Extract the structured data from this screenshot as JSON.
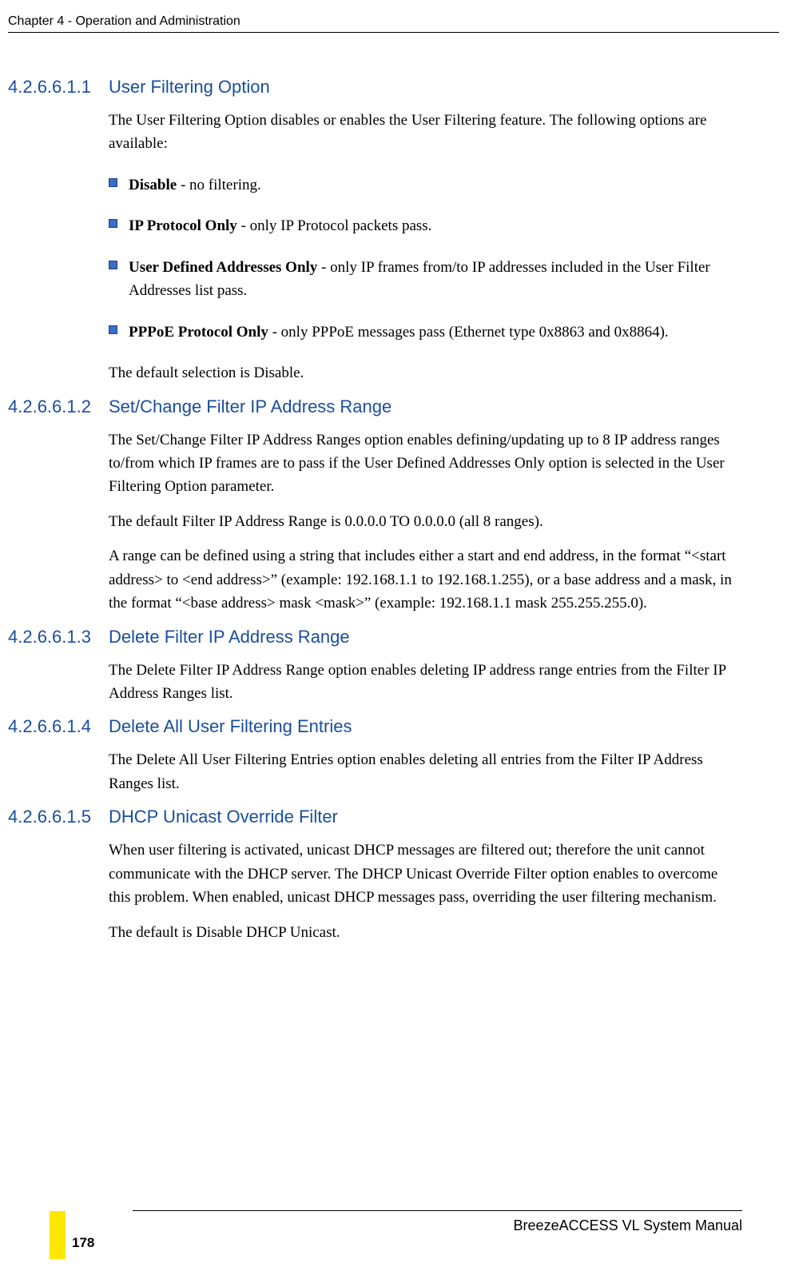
{
  "header": {
    "chapter": "Chapter 4 - Operation and Administration"
  },
  "sections": {
    "s1": {
      "num": "4.2.6.6.1.1",
      "title": "User Filtering Option"
    },
    "s2": {
      "num": "4.2.6.6.1.2",
      "title": "Set/Change Filter IP Address Range"
    },
    "s3": {
      "num": "4.2.6.6.1.3",
      "title": "Delete Filter IP Address Range"
    },
    "s4": {
      "num": "4.2.6.6.1.4",
      "title": "Delete All User Filtering Entries"
    },
    "s5": {
      "num": "4.2.6.6.1.5",
      "title": "DHCP Unicast Override Filter"
    }
  },
  "body": {
    "s1_intro": "The User Filtering Option disables or enables the User Filtering feature. The following options are available:",
    "s1_b1_bold": "Disable",
    "s1_b1_rest": " - no filtering.",
    "s1_b2_bold": "IP Protocol Only",
    "s1_b2_rest": " - only IP Protocol packets pass.",
    "s1_b3_bold": "User Defined Addresses Only",
    "s1_b3_rest": " - only IP frames from/to IP addresses included in the User Filter Addresses list pass.",
    "s1_b4_bold": "PPPoE Protocol Only",
    "s1_b4_rest": " - only PPPoE messages pass (Ethernet type 0x8863 and 0x8864).",
    "s1_outro": "The default selection is Disable.",
    "s2_p1": "The Set/Change Filter IP Address Ranges option enables defining/updating up to 8 IP address ranges to/from which IP frames are to pass if the User Defined Addresses Only option is selected in the User Filtering Option parameter.",
    "s2_p2": "The default Filter IP Address Range is 0.0.0.0 TO 0.0.0.0 (all 8 ranges).",
    "s2_p3": "A range can be defined using a string that includes either a start and end address, in the format “<start address> to <end address>” (example: 192.168.1.1 to 192.168.1.255), or a base address and a mask, in the format “<base address> mask <mask>” (example: 192.168.1.1 mask 255.255.255.0).",
    "s3_p1": "The Delete Filter IP Address Range option enables deleting IP address range entries from the Filter IP Address Ranges list.",
    "s4_p1": "The Delete All User Filtering Entries option enables deleting all entries from the Filter IP Address Ranges list.",
    "s5_p1": "When user filtering is activated, unicast DHCP messages are filtered out; therefore the unit cannot communicate with the DHCP server. The DHCP Unicast Override Filter option enables to overcome this problem. When enabled, unicast DHCP messages pass, overriding the user filtering mechanism.",
    "s5_p2": "The default is Disable DHCP Unicast."
  },
  "footer": {
    "page": "178",
    "manual": "BreezeACCESS VL System Manual"
  }
}
